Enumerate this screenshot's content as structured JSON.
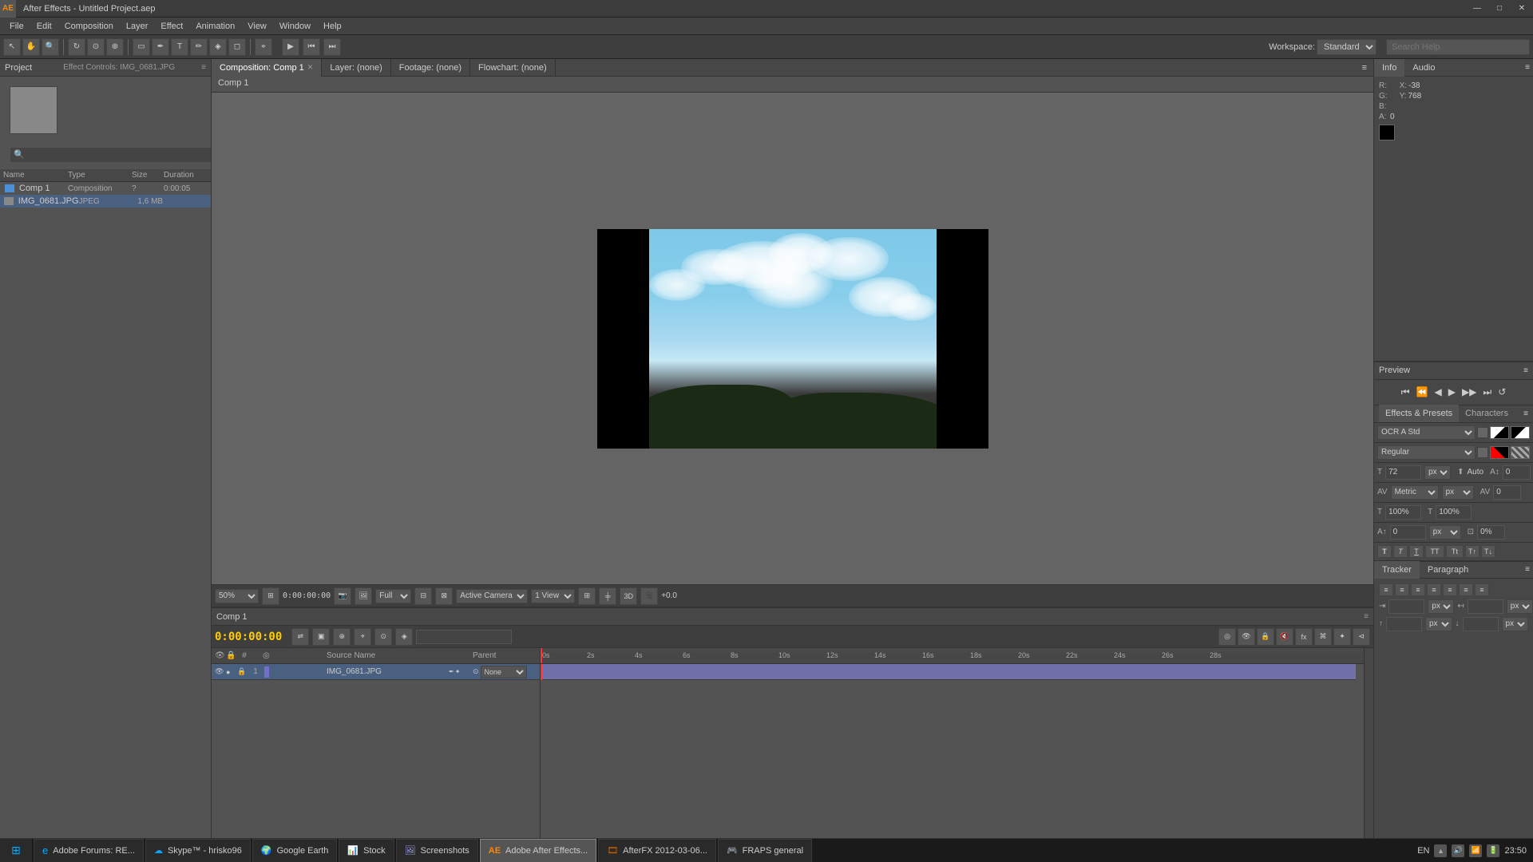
{
  "titlebar": {
    "icon": "AE",
    "title": "After Effects - Untitled Project.aep",
    "min_btn": "—",
    "max_btn": "□",
    "close_btn": "✕"
  },
  "menubar": {
    "items": [
      "File",
      "Edit",
      "Composition",
      "Layer",
      "Effect",
      "Animation",
      "View",
      "Window",
      "Help"
    ]
  },
  "toolbar": {
    "workspace_label": "Workspace:",
    "workspace_value": "Standard",
    "search_placeholder": "Search Help"
  },
  "project_panel": {
    "title": "Project",
    "effect_controls_title": "Effect Controls: IMG_0681.JPG",
    "search_placeholder": "Search",
    "columns": {
      "name": "Name",
      "type": "Type",
      "size": "Size",
      "duration": "Duration"
    },
    "items": [
      {
        "name": "Comp 1",
        "type": "Composition",
        "size": "?",
        "duration": "0:00:05"
      },
      {
        "name": "IMG_0681.JPG",
        "type": "JPEG",
        "size": "1.6 MB",
        "duration": ""
      }
    ]
  },
  "viewer": {
    "tabs": [
      {
        "label": "Composition: Comp 1",
        "active": true
      },
      {
        "label": "Layer: (none)",
        "active": false
      },
      {
        "label": "Footage: (none)",
        "active": false
      },
      {
        "label": "Flowchart: (none)",
        "active": false
      }
    ],
    "comp_label": "Comp 1",
    "zoom": "50%",
    "time": "0:00:00:00",
    "quality": "Full",
    "camera": "Active Camera",
    "view": "1 View",
    "plus_value": "+0.0"
  },
  "info_panel": {
    "tabs": [
      "Info",
      "Audio"
    ],
    "active_tab": "Info",
    "r_label": "R:",
    "g_label": "G:",
    "b_label": "B:",
    "a_label": "A:",
    "r_value": "",
    "g_value": "",
    "b_value": "",
    "a_value": "0",
    "x_label": "X:",
    "x_value": "-38",
    "y_label": "Y:",
    "y_value": "768"
  },
  "preview_panel": {
    "title": "Preview",
    "controls": [
      "⏮",
      "⏪",
      "◀",
      "▶",
      "▶▶",
      "⏭",
      "🔁"
    ]
  },
  "effects_presets": {
    "title": "Effects & Presets",
    "tabs": [
      "Effects & Presets",
      "Characters"
    ]
  },
  "character_panel": {
    "font_name": "OCR A Std",
    "font_style": "Regular",
    "font_size": "72",
    "font_size_unit": "px",
    "auto_label": "Auto",
    "tracking_label": "Metric",
    "tracking_unit": "px",
    "kerning_value": "0",
    "scale_h": "100%",
    "scale_v": "100%",
    "baseline_shift": "0 px",
    "tsume": "0%"
  },
  "tracker_para": {
    "tabs": [
      "Tracker",
      "Paragraph"
    ],
    "active_tab": "Tracker"
  },
  "paragraph_panel": {
    "indent_left": "px",
    "indent_right": "px",
    "space_before": "px",
    "space_after": "px"
  },
  "timeline": {
    "title": "Comp 1",
    "current_time": "0:00:00:00",
    "search_placeholder": "",
    "ruler_marks": [
      "0s",
      "2s",
      "4s",
      "6s",
      "8s",
      "10s",
      "12s",
      "14s",
      "16s",
      "18s",
      "20s",
      "22s",
      "24s",
      "26s",
      "28s"
    ],
    "layers": [
      {
        "number": "1",
        "name": "IMG_0681.JPG",
        "parent": "None",
        "selected": true
      }
    ]
  },
  "taskbar": {
    "start_icon": "⊞",
    "items": [
      {
        "icon": "🌐",
        "label": "Adobe Forums: RE...",
        "active": false
      },
      {
        "icon": "🔵",
        "label": "Skype™ - hrisko96",
        "active": false
      },
      {
        "icon": "🌍",
        "label": "Google Earth",
        "active": false
      },
      {
        "icon": "📦",
        "label": "Stock",
        "active": false
      },
      {
        "icon": "📷",
        "label": "Screenshots",
        "active": false
      },
      {
        "icon": "🎬",
        "label": "Adobe After Effects...",
        "active": true
      },
      {
        "icon": "🎞",
        "label": "AfterFX 2012-03-06...",
        "active": false
      },
      {
        "icon": "🎮",
        "label": "FRAPS general",
        "active": false
      }
    ],
    "lang": "EN",
    "time": "23:50"
  }
}
